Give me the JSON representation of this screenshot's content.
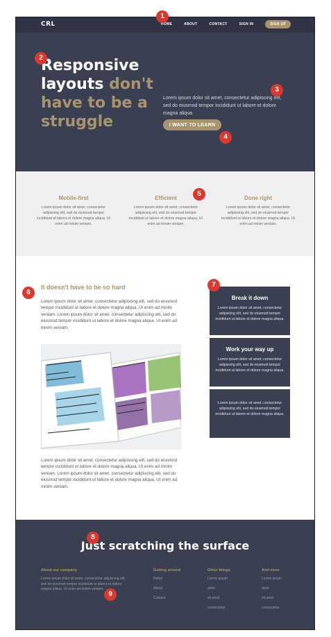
{
  "header": {
    "logo": "CRL",
    "nav": [
      "HOME",
      "ABOUT",
      "CONTACT",
      "SIGN IN"
    ],
    "signup": "SIGN UP"
  },
  "hero": {
    "title_line1": "Responsive",
    "title_line2_white": "layouts",
    "title_line2_gold": "don't",
    "title_line3": "have to be a",
    "title_line4": "struggle",
    "text": "Lorem ipsum dolor sit amet, consectetur adipiscing elit, sed do eiusmod tempor incididunt ut labore et dolore magna aliqua.",
    "cta": "I WANT TO LEARN"
  },
  "features": [
    {
      "title": "Mobile-first",
      "text": "Lorem ipsum dolor sit amet, consectetur adipiscing elit, sed do eiusmod tempor incididunt ut labore et dolore magna aliqua. Ut enim ad minim veniam."
    },
    {
      "title": "Efficient",
      "text": "Lorem ipsum dolor sit amet, consectetur adipiscing elit, sed do eiusmod tempor incididunt ut labore et dolore magna aliqua. Ut enim ad minim veniam."
    },
    {
      "title": "Done right",
      "text": "Lorem ipsum dolor sit amet, consectetur adipiscing elit, sed do eiusmod tempor incididunt ut labore et dolore magna aliqua. Ut enim ad minim veniam."
    }
  ],
  "content": {
    "title": "It doesn't have to be so hard",
    "para1": "Lorem ipsum dolor sit amet, consectetur adipiscing elit, sed do eiusmod tempor incididunt ut labore et dolore magna aliqua. Ut enim ad minim veniam. Lorem ipsum dolor sit amet, consectetur adipiscing elit, sed do eiusmod tempor incididunt ut labore et dolore magna aliqua. Ut enim ad minim veniam.",
    "para2": "Lorem ipsum dolor sit amet, consectetur adipiscing elit, sed do eiusmod tempor incididunt ut labore et dolore magna aliqua. Ut enim ad minim veniam. Lorem ipsum dolor sit amet, consectetur adipiscing elit, sed do eiusmod tempor incididunt ut labore et dolore magna aliqua. Ut enim ad minim veniam."
  },
  "cards": [
    {
      "title": "Break it down",
      "text": "Lorem ipsum dolor sit amet, consectetur adipiscing elit, sed do eiusmod tempor incididunt ut labore et dolore magna aliqua."
    },
    {
      "title": "Work your way up",
      "text": "Lorem ipsum dolor sit amet, consectetur adipiscing elit, sed do eiusmod tempor incididunt ut labore et dolore magna aliqua."
    },
    {
      "title": "",
      "text": "Lorem ipsum dolor sit amet, consectetur adipiscing elit, sed do eiusmod tempor incididunt ut labore et dolore magna aliqua."
    }
  ],
  "footer": {
    "title": "Just scratching the surface",
    "about_heading": "About our company",
    "about_text": "Lorem ipsum dolor sit amet, consectetur adipiscing elit, sed do eiusmod tempor incididunt ut labore et dolore magna aliqua. Ut enim ad minim veniam.",
    "col2_heading": "Getting around",
    "col2_links": [
      "Home",
      "About",
      "Contact"
    ],
    "col3_heading": "Other things",
    "col3_links": [
      "Lorem ipsum",
      "dolor",
      "sit amet",
      "consectetur"
    ],
    "col4_heading": "And more",
    "col4_links": [
      "Lorem ipsum",
      "dolor",
      "sit amet",
      "consectetur"
    ]
  },
  "badges": [
    "1",
    "2",
    "3",
    "4",
    "5",
    "6",
    "7",
    "8",
    "9"
  ],
  "colors": {
    "dark": "#3b3f52",
    "gold": "#a89570",
    "badge": "#d93a2f",
    "light": "#efefef"
  }
}
